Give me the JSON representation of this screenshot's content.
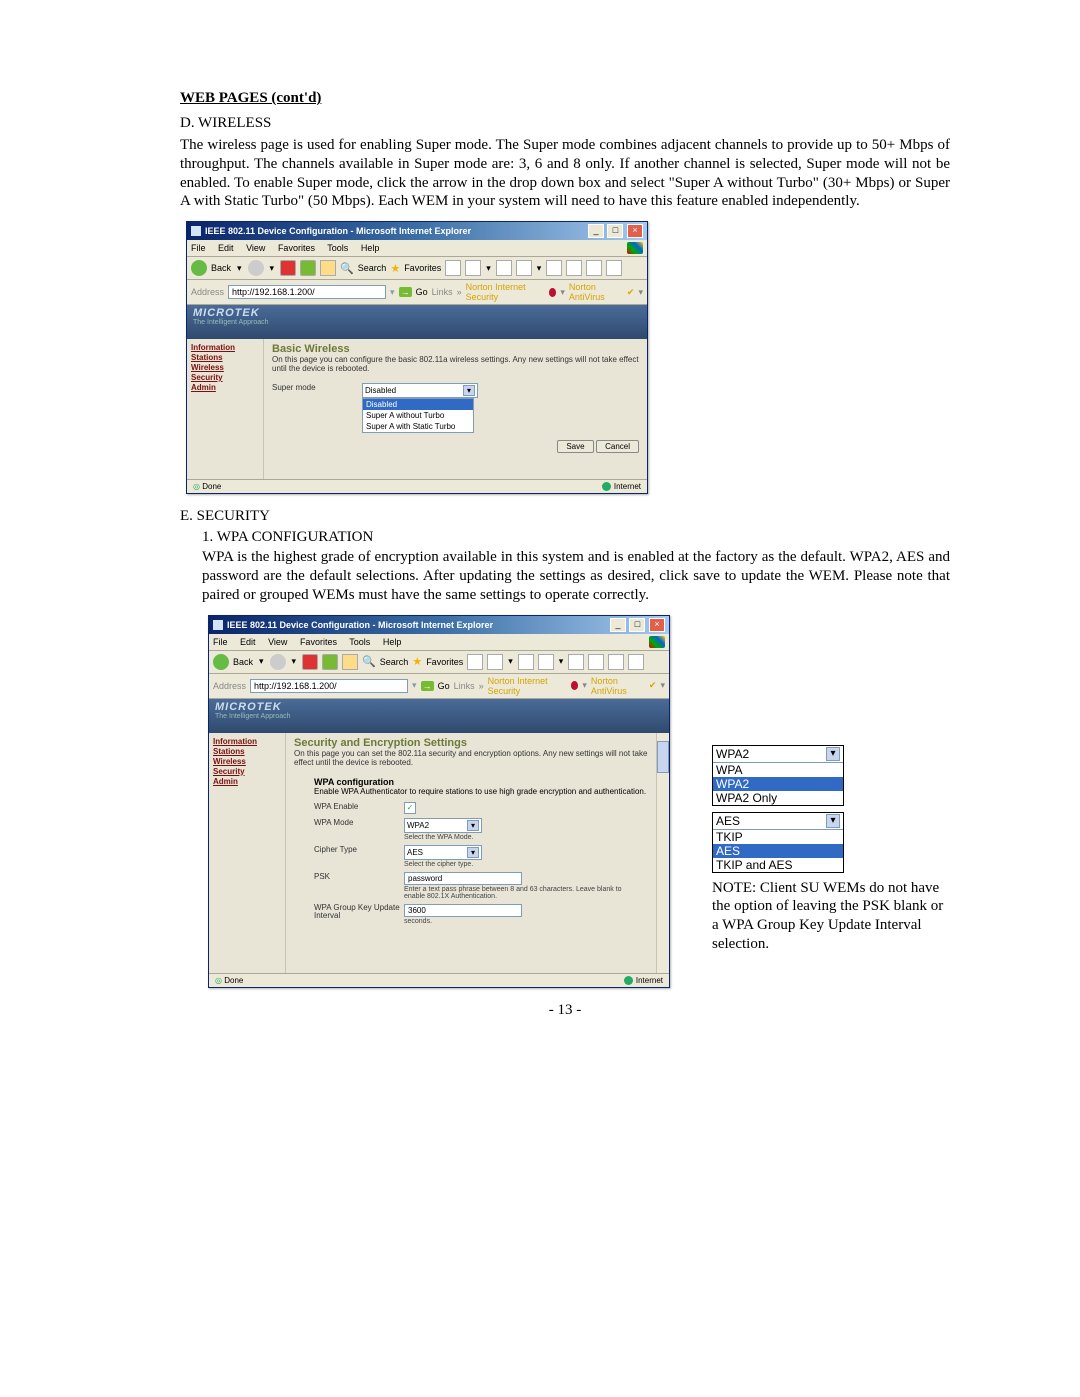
{
  "heading": "WEB PAGES (cont'd)",
  "sectionD": {
    "title": "D.  WIRELESS",
    "body": "The wireless page is used for enabling Super mode.  The Super mode combines adjacent channels to provide up to 50+ Mbps of throughput.  The channels available in Super mode are: 3, 6 and 8 only. If another channel is selected, Super mode will not be enabled.  To enable Super mode, click the arrow in the drop down box and select \"Super A without Turbo\" (30+ Mbps) or Super A with Static Turbo\" (50 Mbps).  Each WEM in your system will need to have this feature enabled independently."
  },
  "sectionE": {
    "title": "E.  SECURITY",
    "sub1": "1.  WPA CONFIGURATION",
    "body": "WPA is the highest grade of encryption available in this system and is enabled at the factory as the default.  WPA2, AES and password are the default selections.  After updating the settings as desired, click save to update the WEM.  Please note that paired or grouped WEMs must have the same settings to operate correctly."
  },
  "ie": {
    "title": "IEEE 802.11 Device Configuration - Microsoft Internet Explorer",
    "menu": [
      "File",
      "Edit",
      "View",
      "Favorites",
      "Tools",
      "Help"
    ],
    "back": "Back",
    "search": "Search",
    "favorites": "Favorites",
    "addressLabel": "Address",
    "url": "http://192.168.1.200/",
    "go": "Go",
    "links": "Links",
    "norton1": "Norton Internet Security",
    "norton2": "Norton AntiVirus",
    "brand": "MICROTEK",
    "brandSub": "The Intelligent Approach",
    "sidebar": [
      "Information",
      "Stations",
      "Wireless",
      "Security",
      "Admin"
    ],
    "statusDone": "Done",
    "statusZone": "Internet",
    "save": "Save",
    "cancel": "Cancel"
  },
  "shot1": {
    "title": "Basic Wireless",
    "sub": "On this page you can configure the basic 802.11a wireless settings. Any new settings will not take effect until the device is rebooted.",
    "label": "Super mode",
    "selected": "Disabled",
    "options": [
      "Disabled",
      "Super A without Turbo",
      "Super A with Static Turbo"
    ]
  },
  "shot2": {
    "title": "Security and Encryption Settings",
    "sub": "On this page you can set the 802.11a security and encryption options. Any new settings will not take effect until the device is rebooted.",
    "wpaConfigTitle": "WPA configuration",
    "wpaConfigSub": "Enable WPA Authenticator to require stations to use high grade encryption and authentication.",
    "rows": {
      "enable": "WPA Enable",
      "mode": "WPA Mode",
      "modeVal": "WPA2",
      "modeHelp": "Select the WPA Mode.",
      "cipher": "Cipher Type",
      "cipherVal": "AES",
      "cipherHelp": "Select the cipher type.",
      "psk": "PSK",
      "pskVal": "password",
      "pskHelp": "Enter a text pass phrase between 8 and 63 characters. Leave blank to enable 802.1X Authentication.",
      "groupKey": "WPA Group Key Update Interval",
      "groupKeyVal": "3600",
      "groupKeyHelp": "seconds."
    }
  },
  "callouts": {
    "wpaMode": {
      "top": "WPA2",
      "opts": [
        "WPA",
        "WPA2",
        "WPA2 Only"
      ],
      "selIndex": 1
    },
    "cipher": {
      "top": "AES",
      "opts": [
        "TKIP",
        "AES",
        "TKIP and AES"
      ],
      "selIndex": 1
    },
    "note": "NOTE:  Client SU WEMs do not have the option of leaving the PSK blank or a WPA Group Key Update Interval selection."
  },
  "footer": "- 13 -"
}
